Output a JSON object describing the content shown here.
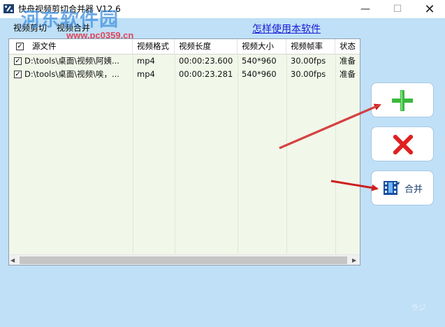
{
  "window": {
    "title": "快舟视频剪切合并器 V12.6",
    "minimize_glyph": "—",
    "maximize_glyph": "☐",
    "close_glyph": "✕"
  },
  "watermark": {
    "brand": "河东软件园",
    "url": "www.pc0359.cn"
  },
  "menu": {
    "items": [
      {
        "label": "视频剪切"
      },
      {
        "label": "视频合并"
      }
    ]
  },
  "help_link": "怎样使用本软件",
  "table": {
    "header_checked": true,
    "columns": [
      "源文件",
      "视频格式",
      "视频长度",
      "视频大小",
      "视频帧率",
      "状态"
    ],
    "rows": [
      {
        "checked": true,
        "file": "D:\\tools\\桌面\\视频\\阿姨...",
        "format": "mp4",
        "duration": "00:00:23.600",
        "size": "540*960",
        "fps": "30.00fps",
        "status": "准备"
      },
      {
        "checked": true,
        "file": "D:\\tools\\桌面\\视频\\唉，...",
        "format": "mp4",
        "duration": "00:00:23.281",
        "size": "540*960",
        "fps": "30.00fps",
        "status": "准备"
      }
    ]
  },
  "buttons": {
    "add_icon": "plus-icon",
    "delete_icon": "x-icon",
    "merge_label": "合并",
    "merge_icon": "film-icon"
  },
  "colors": {
    "background": "#bfe0f7",
    "list_background": "#f1f7e9",
    "plus_green": "#3cb83c",
    "delete_red": "#e02020",
    "link_blue": "#1b1bd6",
    "annotation_arrow": "#cc1f1f"
  },
  "annotations": {
    "arrows": 3
  },
  "corner_mark": "ラジ"
}
